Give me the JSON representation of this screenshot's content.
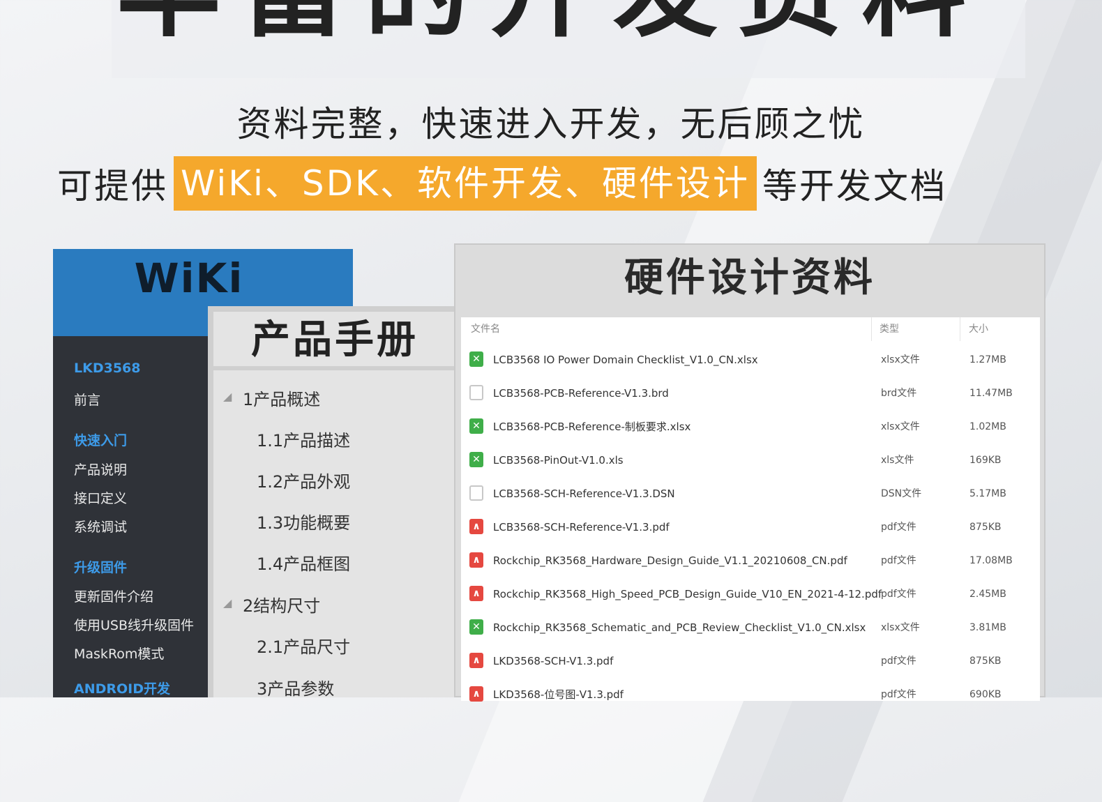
{
  "header": {
    "title": "丰富的开发资料",
    "subtitle": "资料完整，快速进入开发，无后顾之忧",
    "line2_prefix": "可提供",
    "line2_highlight": "WiKi、SDK、软件开发、硬件设计",
    "line2_suffix": "等开发文档",
    "highlight_color": "#f5a82c"
  },
  "wiki": {
    "title": "WiKi",
    "header_color": "#2a7bbf",
    "nav": [
      {
        "label": "LKD3568",
        "section": true
      },
      {
        "label": "前言",
        "section": false
      },
      {
        "label": "快速入门",
        "section": true
      },
      {
        "label": "产品说明",
        "section": false
      },
      {
        "label": "接口定义",
        "section": false
      },
      {
        "label": "系统调试",
        "section": false
      },
      {
        "label": "升级固件",
        "section": true
      },
      {
        "label": "更新固件介绍",
        "section": false
      },
      {
        "label": "使用USB线升级固件",
        "section": false
      },
      {
        "label": "MaskRom模式",
        "section": false
      },
      {
        "label": "ANDROID开发",
        "section": true
      }
    ]
  },
  "manual": {
    "title": "产品手册",
    "toc": [
      {
        "label": "1产品概述",
        "expandable": true
      },
      {
        "label": "1.1产品描述",
        "expandable": false
      },
      {
        "label": "1.2产品外观",
        "expandable": false
      },
      {
        "label": "1.3功能概要",
        "expandable": false
      },
      {
        "label": "1.4产品框图",
        "expandable": false
      },
      {
        "label": "2结构尺寸",
        "expandable": true
      },
      {
        "label": "2.1产品尺寸",
        "expandable": false
      },
      {
        "label": "3产品参数",
        "expandable": false
      }
    ]
  },
  "hardware": {
    "title": "硬件设计资料",
    "columns": {
      "name": "文件名",
      "type": "类型",
      "size": "大小"
    },
    "files": [
      {
        "icon": "xlsx-file-icon",
        "name": "LCB3568 IO Power Domain Checklist_V1.0_CN.xlsx",
        "type": "xlsx文件",
        "size": "1.27MB"
      },
      {
        "icon": "blank-file-icon",
        "name": "LCB3568-PCB-Reference-V1.3.brd",
        "type": "brd文件",
        "size": "11.47MB"
      },
      {
        "icon": "xlsx-file-icon",
        "name": "LCB3568-PCB-Reference-制板要求.xlsx",
        "type": "xlsx文件",
        "size": "1.02MB"
      },
      {
        "icon": "xlsx-file-icon",
        "name": "LCB3568-PinOut-V1.0.xls",
        "type": "xls文件",
        "size": "169KB"
      },
      {
        "icon": "blank-file-icon",
        "name": "LCB3568-SCH-Reference-V1.3.DSN",
        "type": "DSN文件",
        "size": "5.17MB"
      },
      {
        "icon": "pdf-file-icon",
        "name": "LCB3568-SCH-Reference-V1.3.pdf",
        "type": "pdf文件",
        "size": "875KB"
      },
      {
        "icon": "pdf-file-icon",
        "name": "Rockchip_RK3568_Hardware_Design_Guide_V1.1_20210608_CN.pdf",
        "type": "pdf文件",
        "size": "17.08MB"
      },
      {
        "icon": "pdf-file-icon",
        "name": "Rockchip_RK3568_High_Speed_PCB_Design_Guide_V10_EN_2021-4-12.pdf",
        "type": "pdf文件",
        "size": "2.45MB"
      },
      {
        "icon": "xlsx-file-icon",
        "name": "Rockchip_RK3568_Schematic_and_PCB_Review_Checklist_V1.0_CN.xlsx",
        "type": "xlsx文件",
        "size": "3.81MB"
      },
      {
        "icon": "pdf-file-icon",
        "name": "LKD3568-SCH-V1.3.pdf",
        "type": "pdf文件",
        "size": "875KB"
      },
      {
        "icon": "pdf-file-icon",
        "name": "LKD3568-位号图-V1.3.pdf",
        "type": "pdf文件",
        "size": "690KB"
      }
    ]
  }
}
